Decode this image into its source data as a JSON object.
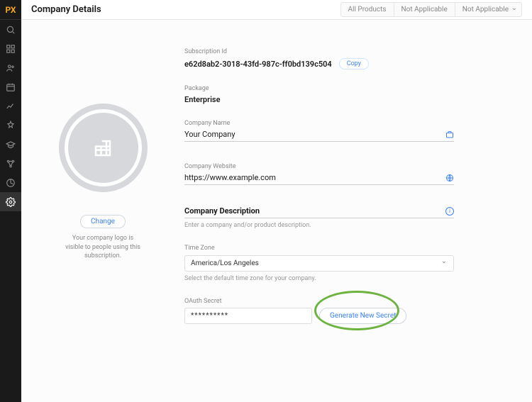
{
  "logo": "PX",
  "header": {
    "title": "Company Details",
    "pills": [
      "All Products",
      "Not Applicable",
      "Not Applicable"
    ]
  },
  "left": {
    "change_label": "Change",
    "caption": "Your company logo is visible to people using this subscription."
  },
  "fields": {
    "subid_label": "Subscription Id",
    "subid_value": "e62d8ab2-3018-43fd-987c-ff0bd139c504",
    "copy_label": "Copy",
    "package_label": "Package",
    "package_value": "Enterprise",
    "name_label": "Company Name",
    "name_value": "Your Company",
    "website_label": "Company Website",
    "website_value": "https://www.example.com",
    "desc_label": "Company Description",
    "desc_placeholder": "Enter a company and/or product description.",
    "tz_label": "Time Zone",
    "tz_value": "America/Los Angeles",
    "tz_helper": "Select the default time zone for your company.",
    "oauth_label": "OAuth Secret",
    "oauth_value": "**********",
    "generate_label": "Generate New Secret"
  }
}
